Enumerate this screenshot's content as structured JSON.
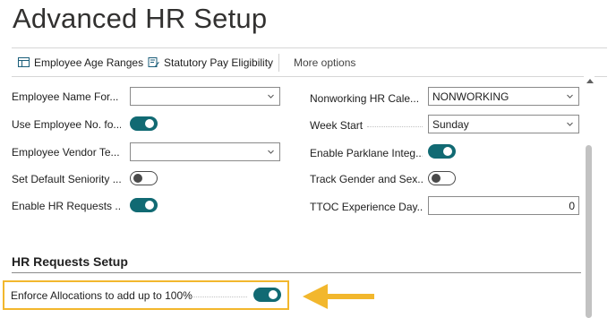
{
  "page": {
    "title": "Advanced HR Setup"
  },
  "toolbar": {
    "employee_age_ranges": "Employee Age Ranges",
    "statutory_pay_eligibility": "Statutory Pay Eligibility",
    "more_options": "More options"
  },
  "left_fields": {
    "employee_name_format": {
      "label": "Employee Name For...",
      "value": ""
    },
    "use_employee_no": {
      "label": "Use Employee No. fo...",
      "on": true
    },
    "employee_vendor_template": {
      "label": "Employee Vendor Te...",
      "value": ""
    },
    "set_default_seniority": {
      "label": "Set Default Seniority ...",
      "on": false
    },
    "enable_hr_requests": {
      "label": "Enable HR Requests ...",
      "on": true
    }
  },
  "right_fields": {
    "nonworking_calendar": {
      "label": "Nonworking HR Cale...",
      "value": "NONWORKING"
    },
    "week_start": {
      "label": "Week Start",
      "value": "Sunday"
    },
    "enable_parklane": {
      "label": "Enable Parklane Integ...",
      "on": true
    },
    "track_gender": {
      "label": "Track Gender and Sex...",
      "on": false
    },
    "ttoc_experience": {
      "label": "TTOC Experience Day...",
      "value": "0"
    }
  },
  "hr_requests_setup": {
    "title": "HR Requests Setup",
    "enforce_allocations": {
      "label": "Enforce Allocations to add up to 100%",
      "on": true
    }
  },
  "colors": {
    "toggle_on": "#116a73",
    "highlight": "#f2b72d",
    "arrow": "#f2b72d"
  }
}
